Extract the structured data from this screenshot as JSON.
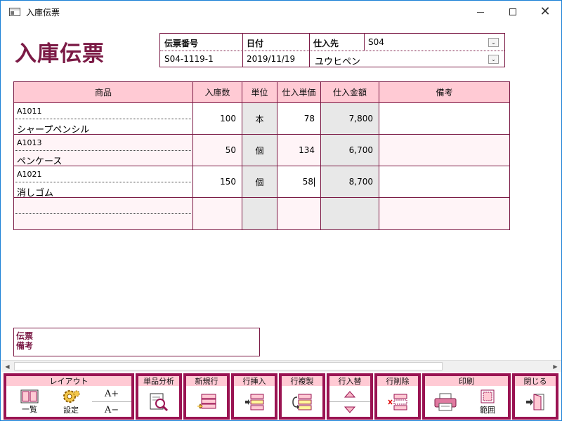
{
  "window": {
    "title": "入庫伝票"
  },
  "page_title": "入庫伝票",
  "header": {
    "slip_no_label": "伝票番号",
    "slip_no": "S04-1119-1",
    "date_label": "日付",
    "date": "2019/11/19",
    "supplier_label": "仕入先",
    "supplier_code": "S04",
    "supplier_name": "ユウヒペン"
  },
  "grid": {
    "columns": [
      "商品",
      "入庫数",
      "単位",
      "仕入単価",
      "仕入金額",
      "備考"
    ],
    "rows": [
      {
        "code": "A1011",
        "name": "シャープペンシル",
        "qty": "100",
        "unit": "本",
        "price": "78",
        "amount": "7,800",
        "note": ""
      },
      {
        "code": "A1013",
        "name": "ペンケース",
        "qty": "50",
        "unit": "個",
        "price": "134",
        "amount": "6,700",
        "note": ""
      },
      {
        "code": "A1021",
        "name": "消しゴム",
        "qty": "150",
        "unit": "個",
        "price": "58",
        "amount": "8,700",
        "note": ""
      },
      {
        "code": "",
        "name": "",
        "qty": "",
        "unit": "",
        "price": "",
        "amount": "",
        "note": ""
      }
    ]
  },
  "memo": {
    "label_line1": "伝票",
    "label_line2": "備考"
  },
  "toolbar": {
    "layout_label": "レイアウト",
    "list_label": "一覧",
    "settings_label": "設定",
    "font_up": "A+",
    "font_down": "A−",
    "analysis_label": "単品分析",
    "new_row_label": "新規行",
    "insert_row_label": "行挿入",
    "copy_row_label": "行複製",
    "swap_row_label": "行入替",
    "delete_row_label": "行削除",
    "print_label": "印刷",
    "range_label": "範囲",
    "close_label": "閉じる"
  },
  "colors": {
    "accent": "#7b1a45",
    "toolbar_border": "#9a1352",
    "header_bg": "#ffcad4"
  }
}
